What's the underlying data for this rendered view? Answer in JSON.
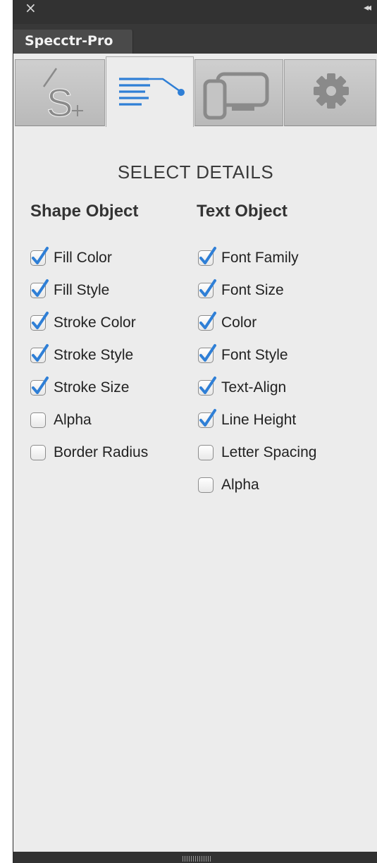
{
  "panel": {
    "title": "Specctr-Pro",
    "close_glyph": "×",
    "collapse_glyph": "◂◂"
  },
  "icon_tabs": [
    {
      "icon": "specctr-logo-icon",
      "active": false
    },
    {
      "icon": "text-details-icon",
      "active": true
    },
    {
      "icon": "devices-icon",
      "active": false
    },
    {
      "icon": "gear-icon",
      "active": false
    }
  ],
  "section_title": "SELECT DETAILS",
  "accent_color": "#2f7fd6",
  "shape_column": {
    "heading": "Shape Object",
    "items": [
      {
        "label": "Fill Color",
        "checked": true
      },
      {
        "label": "Fill Style",
        "checked": true
      },
      {
        "label": "Stroke Color",
        "checked": true
      },
      {
        "label": "Stroke Style",
        "checked": true
      },
      {
        "label": "Stroke Size",
        "checked": true
      },
      {
        "label": "Alpha",
        "checked": false
      },
      {
        "label": "Border Radius",
        "checked": false
      }
    ]
  },
  "text_column": {
    "heading": "Text Object",
    "items": [
      {
        "label": "Font Family",
        "checked": true
      },
      {
        "label": "Font Size",
        "checked": true
      },
      {
        "label": "Color",
        "checked": true
      },
      {
        "label": "Font Style",
        "checked": true
      },
      {
        "label": "Text-Align",
        "checked": true
      },
      {
        "label": "Line Height",
        "checked": true
      },
      {
        "label": "Letter Spacing",
        "checked": false
      },
      {
        "label": "Alpha",
        "checked": false
      }
    ]
  }
}
